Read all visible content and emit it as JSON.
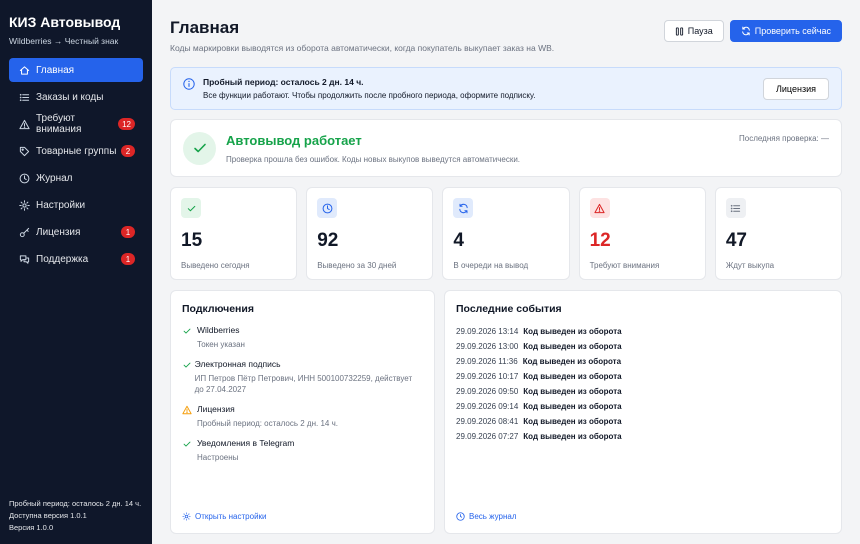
{
  "brand": {
    "title": "КИЗ Автовывод",
    "subtitle": "Wildberries → Честный знак"
  },
  "nav": [
    {
      "label": "Главная",
      "icon": "home-icon",
      "active": true,
      "badge": null
    },
    {
      "label": "Заказы и коды",
      "icon": "list-icon",
      "active": false,
      "badge": null
    },
    {
      "label": "Требуют внимания",
      "icon": "warning-icon",
      "active": false,
      "badge": "12"
    },
    {
      "label": "Товарные группы",
      "icon": "tag-icon",
      "active": false,
      "badge": "2"
    },
    {
      "label": "Журнал",
      "icon": "clock-icon",
      "active": false,
      "badge": null
    },
    {
      "label": "Настройки",
      "icon": "gear-icon",
      "active": false,
      "badge": null
    },
    {
      "label": "Лицензия",
      "icon": "key-icon",
      "active": false,
      "badge": "1"
    },
    {
      "label": "Поддержка",
      "icon": "chat-icon",
      "active": false,
      "badge": "1"
    }
  ],
  "sidebar_footer": {
    "trial": "Пробный период: осталось 2 дн. 14 ч.",
    "available": "Доступна версия 1.0.1",
    "version": "Версия 1.0.0"
  },
  "header": {
    "title": "Главная",
    "subtitle": "Коды маркировки выводятся из оборота автоматически, когда покупатель выкупает заказ на WB.",
    "pause_label": "Пауза",
    "check_label": "Проверить сейчас"
  },
  "trial_banner": {
    "title": "Пробный период: осталось 2 дн. 14 ч.",
    "text": "Все функции работают. Чтобы продолжить после пробного периода, оформите подписку.",
    "button": "Лицензия"
  },
  "status": {
    "title": "Автовывод работает",
    "text": "Проверка прошла без ошибок. Коды новых выкупов выведутся автоматически.",
    "last_check": "Последняя проверка: —"
  },
  "stats": [
    {
      "value": "15",
      "label": "Выведено сегодня",
      "icon": "check-icon",
      "color": "#16a34a",
      "bg": "#e3f5e9",
      "value_color": "#111827"
    },
    {
      "value": "92",
      "label": "Выведено за 30 дней",
      "icon": "clock-icon",
      "color": "#2563eb",
      "bg": "#e0eafc",
      "value_color": "#111827"
    },
    {
      "value": "4",
      "label": "В очереди на вывод",
      "icon": "refresh-icon",
      "color": "#2563eb",
      "bg": "#e0eafc",
      "value_color": "#111827"
    },
    {
      "value": "12",
      "label": "Требуют внимания",
      "icon": "warning-icon",
      "color": "#dc2626",
      "bg": "#fde2e2",
      "value_color": "#dc2626"
    },
    {
      "value": "47",
      "label": "Ждут выкупа",
      "icon": "list-icon",
      "color": "#6b7280",
      "bg": "#eef0f3",
      "value_color": "#111827"
    }
  ],
  "connections": {
    "title": "Подключения",
    "items": [
      {
        "name": "Wildberries",
        "desc": "Токен указан",
        "status": "ok"
      },
      {
        "name": "Электронная подпись",
        "desc": "ИП Петров Пётр Петрович, ИНН 500100732259, действует до 27.04.2027",
        "status": "ok"
      },
      {
        "name": "Лицензия",
        "desc": "Пробный период: осталось 2 дн. 14 ч.",
        "status": "warn"
      },
      {
        "name": "Уведомления в Telegram",
        "desc": "Настроены",
        "status": "ok"
      }
    ],
    "link": "Открыть настройки"
  },
  "events": {
    "title": "Последние события",
    "items": [
      {
        "time": "29.09.2026 13:14",
        "text": "Код выведен из оборота"
      },
      {
        "time": "29.09.2026 13:00",
        "text": "Код выведен из оборота"
      },
      {
        "time": "29.09.2026 11:36",
        "text": "Код выведен из оборота"
      },
      {
        "time": "29.09.2026 10:17",
        "text": "Код выведен из оборота"
      },
      {
        "time": "29.09.2026 09:50",
        "text": "Код выведен из оборота"
      },
      {
        "time": "29.09.2026 09:14",
        "text": "Код выведен из оборота"
      },
      {
        "time": "29.09.2026 08:41",
        "text": "Код выведен из оборота"
      },
      {
        "time": "29.09.2026 07:27",
        "text": "Код выведен из оборота"
      }
    ],
    "link": "Весь журнал"
  },
  "colors": {
    "accent": "#2563eb",
    "sidebar": "#0f172a",
    "success": "#16a34a",
    "danger": "#dc2626",
    "warning": "#f59e0b"
  }
}
